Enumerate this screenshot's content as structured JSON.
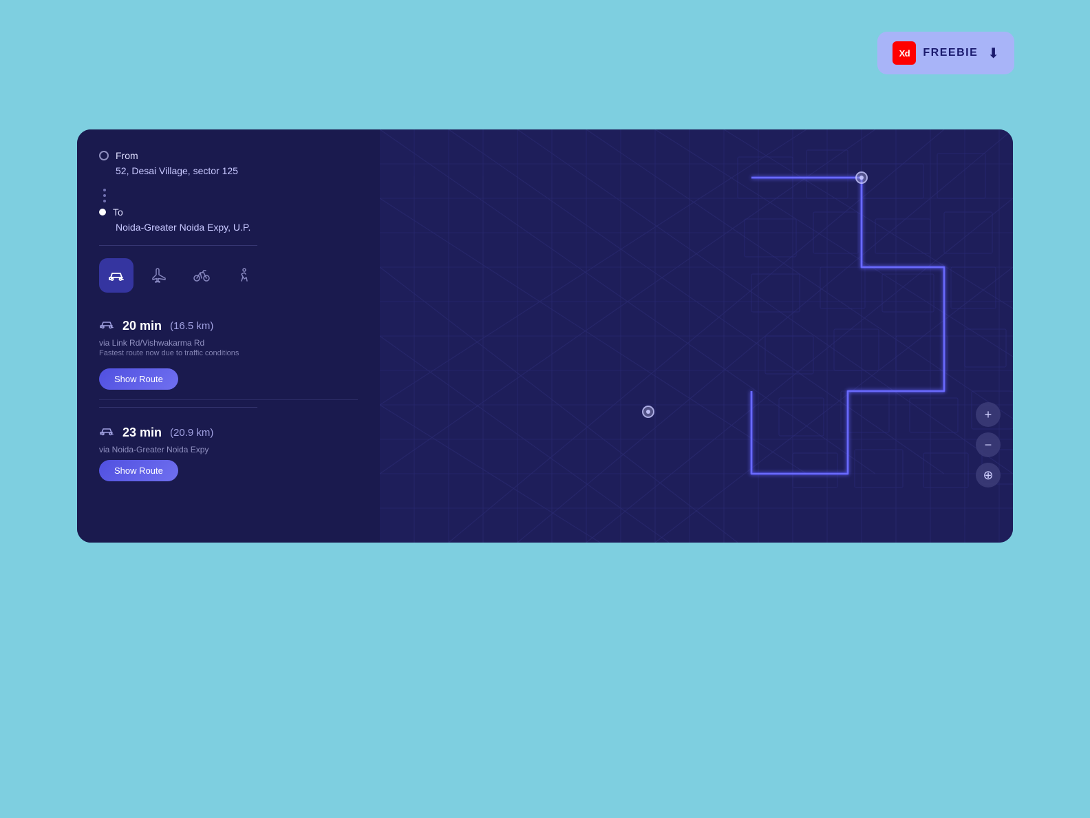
{
  "freebie": {
    "xd_label": "Xd",
    "label": "FREEBIE",
    "download_icon": "⬇"
  },
  "map_card": {
    "from": {
      "label": "From",
      "address": "52, Desai Village, sector 125"
    },
    "to": {
      "label": "To",
      "address": "Noida-Greater Noida Expy, U.P."
    },
    "transport_modes": [
      {
        "key": "car",
        "icon": "🚗",
        "active": true,
        "label": "Car"
      },
      {
        "key": "flight",
        "icon": "✈",
        "active": false,
        "label": "Flight"
      },
      {
        "key": "bike",
        "icon": "🚲",
        "active": false,
        "label": "Bike"
      },
      {
        "key": "walk",
        "icon": "🚶",
        "active": false,
        "label": "Walk"
      }
    ],
    "routes": [
      {
        "time": "20 min",
        "distance": "(16.5 km)",
        "via": "via Link Rd/Vishwakarma Rd",
        "note": "Fastest route now due to traffic conditions",
        "btn_label": "Show Route"
      },
      {
        "time": "23 min",
        "distance": "(20.9 km)",
        "via": "via Noida-Greater Noida Expy",
        "note": "",
        "btn_label": "Show Route"
      }
    ]
  },
  "map_controls": {
    "zoom_in": "+",
    "zoom_out": "−",
    "locate": "⊕"
  }
}
